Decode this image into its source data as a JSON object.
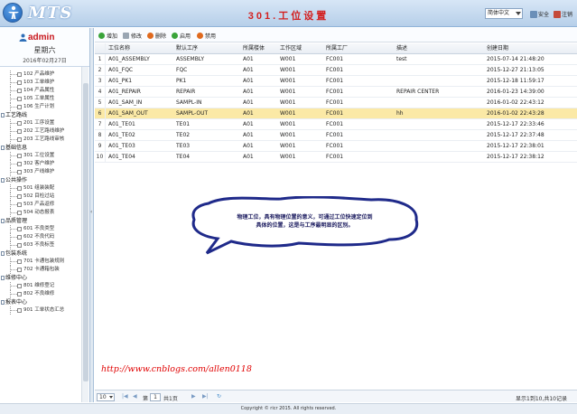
{
  "header": {
    "app_name": "MTS",
    "page_title": "301.工位设置",
    "language": "简体中文",
    "security_label": "安全",
    "logout_label": "注销"
  },
  "sidebar": {
    "user": "admin",
    "weekday": "星期六",
    "date": "2016年02月27日",
    "menu": [
      {
        "type": "item",
        "label": "102 产品维护"
      },
      {
        "type": "item",
        "label": "103 工单维护"
      },
      {
        "type": "item",
        "label": "104 产品属性"
      },
      {
        "type": "item",
        "label": "105 工单属性"
      },
      {
        "type": "item",
        "label": "106 生产计划"
      },
      {
        "type": "group",
        "label": "工艺路线"
      },
      {
        "type": "item",
        "label": "201 工序设置"
      },
      {
        "type": "item",
        "label": "202 工艺路线维护"
      },
      {
        "type": "item",
        "label": "203 工艺路线审核"
      },
      {
        "type": "group",
        "label": "基础信息"
      },
      {
        "type": "item",
        "label": "301 工位设置"
      },
      {
        "type": "item",
        "label": "302 客户维护"
      },
      {
        "type": "item",
        "label": "303 产线维护"
      },
      {
        "type": "group",
        "label": "公共操作"
      },
      {
        "type": "item",
        "label": "501 组装装配"
      },
      {
        "type": "item",
        "label": "502 目检过站"
      },
      {
        "type": "item",
        "label": "503 产品返修"
      },
      {
        "type": "item",
        "label": "504 动态报表"
      },
      {
        "type": "group",
        "label": "品质管理"
      },
      {
        "type": "item",
        "label": "601 不良类型"
      },
      {
        "type": "item",
        "label": "602 不良代码"
      },
      {
        "type": "item",
        "label": "603 不良标签"
      },
      {
        "type": "group",
        "label": "包装系统"
      },
      {
        "type": "item",
        "label": "701 卡通包装规则"
      },
      {
        "type": "item",
        "label": "702 卡通箱包装"
      },
      {
        "type": "group",
        "label": "维修中心"
      },
      {
        "type": "item",
        "label": "801 维修登记"
      },
      {
        "type": "item",
        "label": "802 不良维修"
      },
      {
        "type": "group",
        "label": "报表中心"
      },
      {
        "type": "item",
        "label": "901 工单状态汇总"
      }
    ]
  },
  "toolbar": {
    "add": "增加",
    "edit": "修改",
    "delete": "删除",
    "enable": "启用",
    "disable": "禁用"
  },
  "table": {
    "columns": [
      "工位名称",
      "默认工序",
      "所属楼体",
      "工作区域",
      "所属工厂",
      "描述",
      "创建日期"
    ],
    "rows": [
      [
        "1",
        "A01_ASSEMBLY",
        "ASSEMBLY",
        "A01",
        "W001",
        "FC001",
        "test",
        "2015-07-14 21:48:20"
      ],
      [
        "2",
        "A01_FQC",
        "FQC",
        "A01",
        "W001",
        "FC001",
        "",
        "2015-12-27 21:13:05"
      ],
      [
        "3",
        "A01_PK1",
        "PK1",
        "A01",
        "W001",
        "FC001",
        "",
        "2015-12-18 11:59:17"
      ],
      [
        "4",
        "A01_REPAIR",
        "REPAIR",
        "A01",
        "W001",
        "FC001",
        "REPAIR CENTER",
        "2016-01-23 14:39:00"
      ],
      [
        "5",
        "A01_SAM_IN",
        "SAMPL-IN",
        "A01",
        "W001",
        "FC001",
        "",
        "2016-01-02 22:43:12"
      ],
      [
        "6",
        "A01_SAM_OUT",
        "SAMPL-OUT",
        "A01",
        "W001",
        "FC001",
        "hh",
        "2016-01-02 22:43:28"
      ],
      [
        "7",
        "A01_TE01",
        "TE01",
        "A01",
        "W001",
        "FC001",
        "",
        "2015-12-17 22:33:46"
      ],
      [
        "8",
        "A01_TE02",
        "TE02",
        "A01",
        "W001",
        "FC001",
        "",
        "2015-12-17 22:37:48"
      ],
      [
        "9",
        "A01_TE03",
        "TE03",
        "A01",
        "W001",
        "FC001",
        "",
        "2015-12-17 22:38:01"
      ],
      [
        "10",
        "A01_TE04",
        "TE04",
        "A01",
        "W001",
        "FC001",
        "",
        "2015-12-17 22:38:12"
      ]
    ],
    "selected_row": 5
  },
  "annotation": {
    "line1": "物理工位，具有物理位置的意义，可通过工位快速定位到",
    "line2": "具体的位置，这是与工序最明显的区别。"
  },
  "watermark": "http://www.cnblogs.com/allen0118",
  "pager": {
    "page_size": "10",
    "page_prefix": "第",
    "page_value": "1",
    "page_suffix": "共1页",
    "summary": "显示1到10,共10记录"
  },
  "footer": "Copyright © ricr 2015. All rights reserved.",
  "colors": {
    "title_red": "#d31f1f",
    "selected_row": "#fbe9a6",
    "header_blue": "#b6cfe9"
  }
}
